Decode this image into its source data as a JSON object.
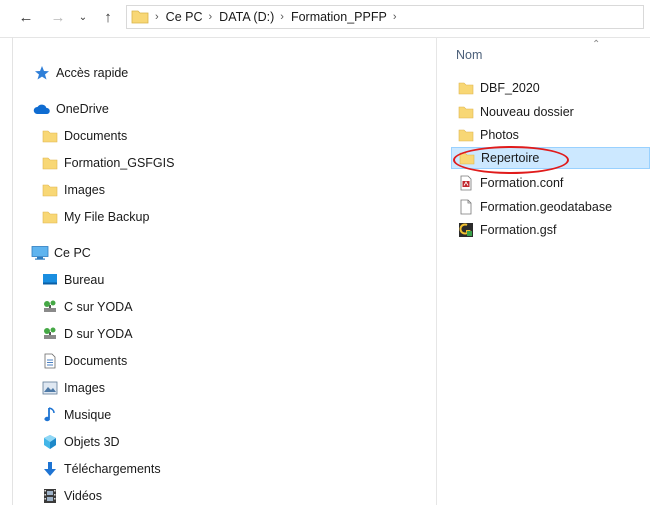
{
  "address_bar": {
    "breadcrumbs": [
      "Ce PC",
      "DATA (D:)",
      "Formation_PPFP"
    ]
  },
  "nav_pane": {
    "quick_access": "Accès rapide",
    "onedrive": {
      "label": "OneDrive",
      "children": [
        "Documents",
        "Formation_GSFGIS",
        "Images",
        "My File Backup"
      ]
    },
    "this_pc": {
      "label": "Ce PC",
      "children": [
        "Bureau",
        "C sur YODA",
        "D sur YODA",
        "Documents",
        "Images",
        "Musique",
        "Objets 3D",
        "Téléchargements",
        "Vidéos"
      ]
    }
  },
  "content": {
    "column_name": "Nom",
    "items": [
      {
        "name": "DBF_2020",
        "icon": "folder-icon"
      },
      {
        "name": "Nouveau dossier",
        "icon": "folder-icon"
      },
      {
        "name": "Photos",
        "icon": "folder-icon"
      },
      {
        "name": "Repertoire",
        "icon": "folder-icon",
        "selected": true
      },
      {
        "name": "Formation.conf",
        "icon": "conf-file-icon"
      },
      {
        "name": "Formation.geodatabase",
        "icon": "blank-file-icon"
      },
      {
        "name": "Formation.gsf",
        "icon": "gsf-file-icon"
      }
    ]
  },
  "colors": {
    "selection_bg": "#cce8ff",
    "selection_border": "#99d1ff",
    "annotation": "#e01b1b",
    "folder": "#f8d775"
  }
}
